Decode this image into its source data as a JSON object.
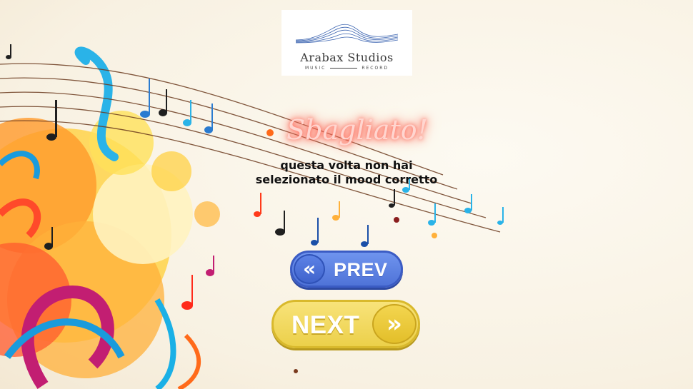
{
  "logo": {
    "name": "Arabax Studios",
    "tag_left": "MUSIC",
    "tag_right": "RECORD"
  },
  "message": {
    "headline": "Sbagliato!",
    "line1": "questa volta non hai",
    "line2": "selezionato il mood corretto"
  },
  "buttons": {
    "prev_icon": "«",
    "prev_label": "PREV",
    "next_label": "NEXT",
    "next_icon": "»"
  },
  "colors": {
    "headline_glow": "#ff5544",
    "prev_button": "#5a7fe3",
    "next_button": "#f0d85a"
  }
}
